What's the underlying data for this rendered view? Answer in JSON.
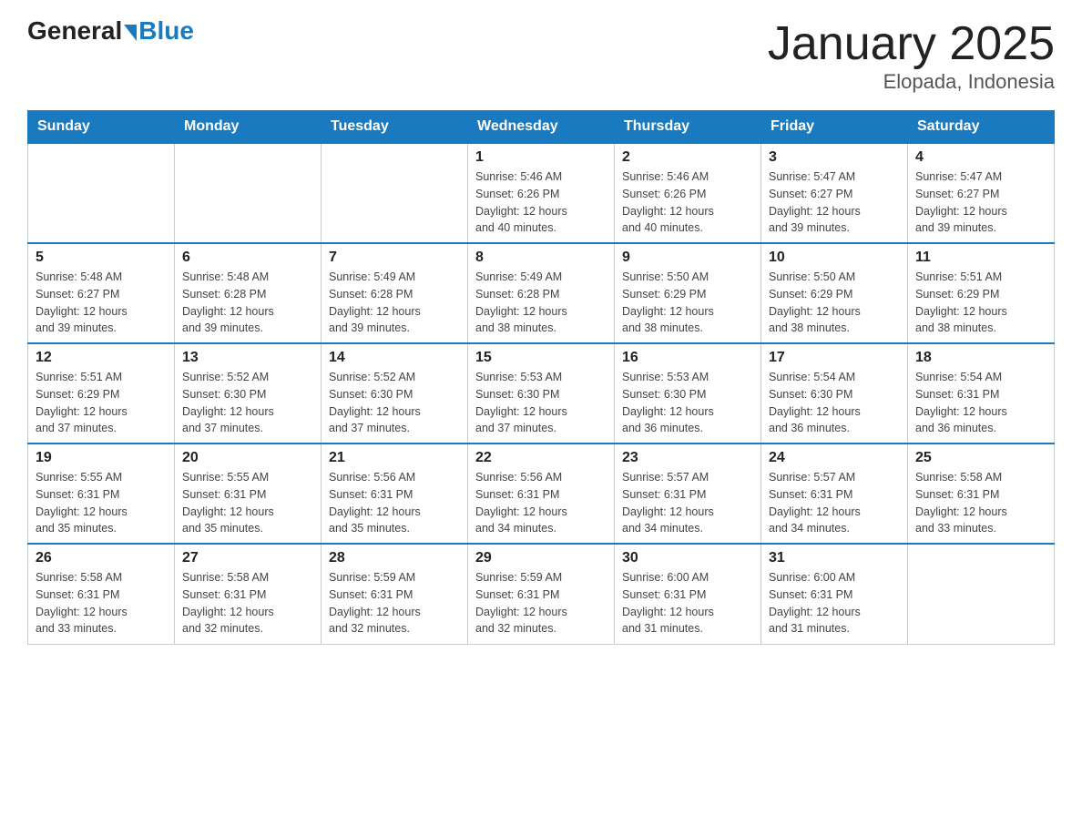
{
  "header": {
    "logo_general": "General",
    "logo_blue": "Blue",
    "title": "January 2025",
    "subtitle": "Elopada, Indonesia"
  },
  "days_of_week": [
    "Sunday",
    "Monday",
    "Tuesday",
    "Wednesday",
    "Thursday",
    "Friday",
    "Saturday"
  ],
  "weeks": [
    [
      {
        "day": "",
        "info": ""
      },
      {
        "day": "",
        "info": ""
      },
      {
        "day": "",
        "info": ""
      },
      {
        "day": "1",
        "info": "Sunrise: 5:46 AM\nSunset: 6:26 PM\nDaylight: 12 hours\nand 40 minutes."
      },
      {
        "day": "2",
        "info": "Sunrise: 5:46 AM\nSunset: 6:26 PM\nDaylight: 12 hours\nand 40 minutes."
      },
      {
        "day": "3",
        "info": "Sunrise: 5:47 AM\nSunset: 6:27 PM\nDaylight: 12 hours\nand 39 minutes."
      },
      {
        "day": "4",
        "info": "Sunrise: 5:47 AM\nSunset: 6:27 PM\nDaylight: 12 hours\nand 39 minutes."
      }
    ],
    [
      {
        "day": "5",
        "info": "Sunrise: 5:48 AM\nSunset: 6:27 PM\nDaylight: 12 hours\nand 39 minutes."
      },
      {
        "day": "6",
        "info": "Sunrise: 5:48 AM\nSunset: 6:28 PM\nDaylight: 12 hours\nand 39 minutes."
      },
      {
        "day": "7",
        "info": "Sunrise: 5:49 AM\nSunset: 6:28 PM\nDaylight: 12 hours\nand 39 minutes."
      },
      {
        "day": "8",
        "info": "Sunrise: 5:49 AM\nSunset: 6:28 PM\nDaylight: 12 hours\nand 38 minutes."
      },
      {
        "day": "9",
        "info": "Sunrise: 5:50 AM\nSunset: 6:29 PM\nDaylight: 12 hours\nand 38 minutes."
      },
      {
        "day": "10",
        "info": "Sunrise: 5:50 AM\nSunset: 6:29 PM\nDaylight: 12 hours\nand 38 minutes."
      },
      {
        "day": "11",
        "info": "Sunrise: 5:51 AM\nSunset: 6:29 PM\nDaylight: 12 hours\nand 38 minutes."
      }
    ],
    [
      {
        "day": "12",
        "info": "Sunrise: 5:51 AM\nSunset: 6:29 PM\nDaylight: 12 hours\nand 37 minutes."
      },
      {
        "day": "13",
        "info": "Sunrise: 5:52 AM\nSunset: 6:30 PM\nDaylight: 12 hours\nand 37 minutes."
      },
      {
        "day": "14",
        "info": "Sunrise: 5:52 AM\nSunset: 6:30 PM\nDaylight: 12 hours\nand 37 minutes."
      },
      {
        "day": "15",
        "info": "Sunrise: 5:53 AM\nSunset: 6:30 PM\nDaylight: 12 hours\nand 37 minutes."
      },
      {
        "day": "16",
        "info": "Sunrise: 5:53 AM\nSunset: 6:30 PM\nDaylight: 12 hours\nand 36 minutes."
      },
      {
        "day": "17",
        "info": "Sunrise: 5:54 AM\nSunset: 6:30 PM\nDaylight: 12 hours\nand 36 minutes."
      },
      {
        "day": "18",
        "info": "Sunrise: 5:54 AM\nSunset: 6:31 PM\nDaylight: 12 hours\nand 36 minutes."
      }
    ],
    [
      {
        "day": "19",
        "info": "Sunrise: 5:55 AM\nSunset: 6:31 PM\nDaylight: 12 hours\nand 35 minutes."
      },
      {
        "day": "20",
        "info": "Sunrise: 5:55 AM\nSunset: 6:31 PM\nDaylight: 12 hours\nand 35 minutes."
      },
      {
        "day": "21",
        "info": "Sunrise: 5:56 AM\nSunset: 6:31 PM\nDaylight: 12 hours\nand 35 minutes."
      },
      {
        "day": "22",
        "info": "Sunrise: 5:56 AM\nSunset: 6:31 PM\nDaylight: 12 hours\nand 34 minutes."
      },
      {
        "day": "23",
        "info": "Sunrise: 5:57 AM\nSunset: 6:31 PM\nDaylight: 12 hours\nand 34 minutes."
      },
      {
        "day": "24",
        "info": "Sunrise: 5:57 AM\nSunset: 6:31 PM\nDaylight: 12 hours\nand 34 minutes."
      },
      {
        "day": "25",
        "info": "Sunrise: 5:58 AM\nSunset: 6:31 PM\nDaylight: 12 hours\nand 33 minutes."
      }
    ],
    [
      {
        "day": "26",
        "info": "Sunrise: 5:58 AM\nSunset: 6:31 PM\nDaylight: 12 hours\nand 33 minutes."
      },
      {
        "day": "27",
        "info": "Sunrise: 5:58 AM\nSunset: 6:31 PM\nDaylight: 12 hours\nand 32 minutes."
      },
      {
        "day": "28",
        "info": "Sunrise: 5:59 AM\nSunset: 6:31 PM\nDaylight: 12 hours\nand 32 minutes."
      },
      {
        "day": "29",
        "info": "Sunrise: 5:59 AM\nSunset: 6:31 PM\nDaylight: 12 hours\nand 32 minutes."
      },
      {
        "day": "30",
        "info": "Sunrise: 6:00 AM\nSunset: 6:31 PM\nDaylight: 12 hours\nand 31 minutes."
      },
      {
        "day": "31",
        "info": "Sunrise: 6:00 AM\nSunset: 6:31 PM\nDaylight: 12 hours\nand 31 minutes."
      },
      {
        "day": "",
        "info": ""
      }
    ]
  ]
}
